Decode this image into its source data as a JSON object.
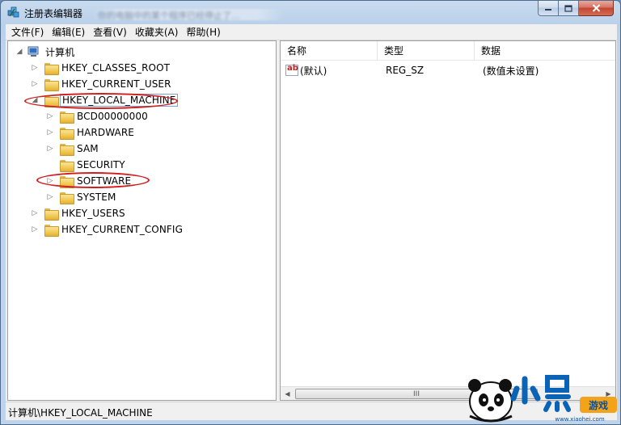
{
  "window": {
    "title": "注册表编辑器",
    "blurred_doc_title": "你的电脑中的某个程序已经停止了..."
  },
  "menu": [
    "文件(F)",
    "编辑(E)",
    "查看(V)",
    "收藏夹(A)",
    "帮助(H)"
  ],
  "tree": {
    "root": "计算机",
    "nodes": [
      {
        "label": "HKEY_CLASSES_ROOT"
      },
      {
        "label": "HKEY_CURRENT_USER"
      },
      {
        "label": "HKEY_LOCAL_MACHINE",
        "selected": true
      },
      {
        "label": "BCD00000000"
      },
      {
        "label": "HARDWARE"
      },
      {
        "label": "SAM"
      },
      {
        "label": "SECURITY"
      },
      {
        "label": "SOFTWARE"
      },
      {
        "label": "SYSTEM"
      },
      {
        "label": "HKEY_USERS"
      },
      {
        "label": "HKEY_CURRENT_CONFIG"
      }
    ]
  },
  "list": {
    "columns": [
      "名称",
      "类型",
      "数据"
    ],
    "rows": [
      {
        "name": "(默认)",
        "type": "REG_SZ",
        "data": "(数值未设置)"
      }
    ],
    "scroll_thumb_label": "III"
  },
  "status": {
    "path": "计算机\\HKEY_LOCAL_MACHINE"
  },
  "watermark": {
    "brand_text": "小黑游戏",
    "url": "www.xiaohei.com"
  },
  "colors": {
    "highlight_ellipse": "#d11d1d",
    "selection_border": "#7da2ce"
  }
}
